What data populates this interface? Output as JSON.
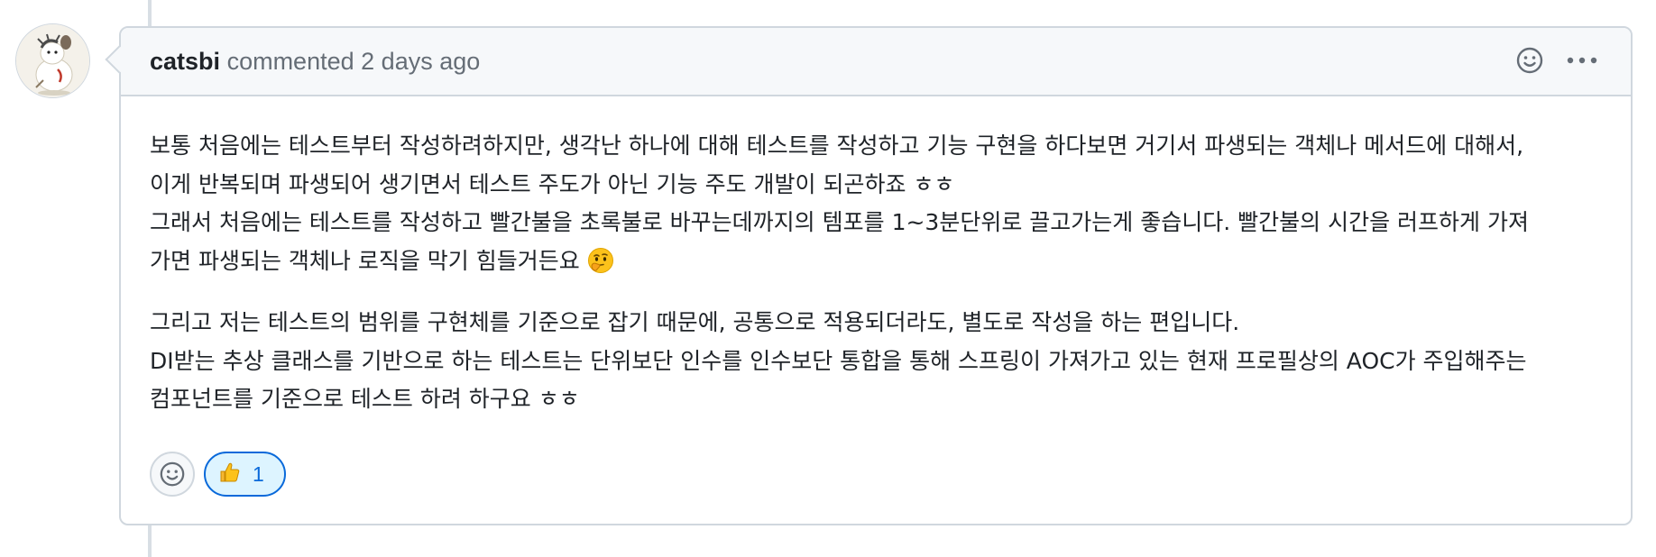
{
  "comment": {
    "author": "catsbi",
    "action_text": "commented",
    "timestamp": "2 days ago",
    "paragraphs": [
      {
        "lines": [
          "보통 처음에는 테스트부터 작성하려하지만, 생각난 하나에 대해 테스트를 작성하고 기능 구현을 하다보면 거기서 파생되는 객체나 메서드에 대해서,",
          "이게 반복되며 파생되어 생기면서 테스트 주도가 아닌 기능 주도 개발이 되곤하죠 ㅎㅎ",
          "그래서 처음에는 테스트를 작성하고 빨간불을 초록불로 바꾸는데까지의 템포를 1~3분단위로 끌고가는게 좋습니다. 빨간불의 시간을 러프하게 가져",
          "가면 파생되는 객체나 로직을 막기 힘들거든요"
        ],
        "trailing_emoji": "thinking-face"
      },
      {
        "lines": [
          "그리고 저는 테스트의 범위를 구현체를 기준으로 잡기 때문에, 공통으로 적용되더라도, 별도로 작성을 하는 편입니다.",
          "DI받는 추상 클래스를 기반으로 하는 테스트는 단위보단 인수를 인수보단 통합을 통해 스프링이 가져가고 있는 현재 프로필상의 AOC가 주입해주는",
          "컴포넌트를 기준으로 테스트 하려 하구요 ㅎㅎ"
        ]
      }
    ],
    "header_icons": [
      "smiley-icon",
      "kebab-menu-icon"
    ],
    "reactions": [
      {
        "emoji": "👍",
        "emoji_name": "thumbs-up",
        "count": "1",
        "selected": true
      }
    ]
  },
  "colors": {
    "header_bg": "#f6f8fa",
    "border": "#d0d7de",
    "text": "#1f2328",
    "muted": "#656d76",
    "accent": "#0969da",
    "reaction_bg": "#ddf4ff"
  }
}
